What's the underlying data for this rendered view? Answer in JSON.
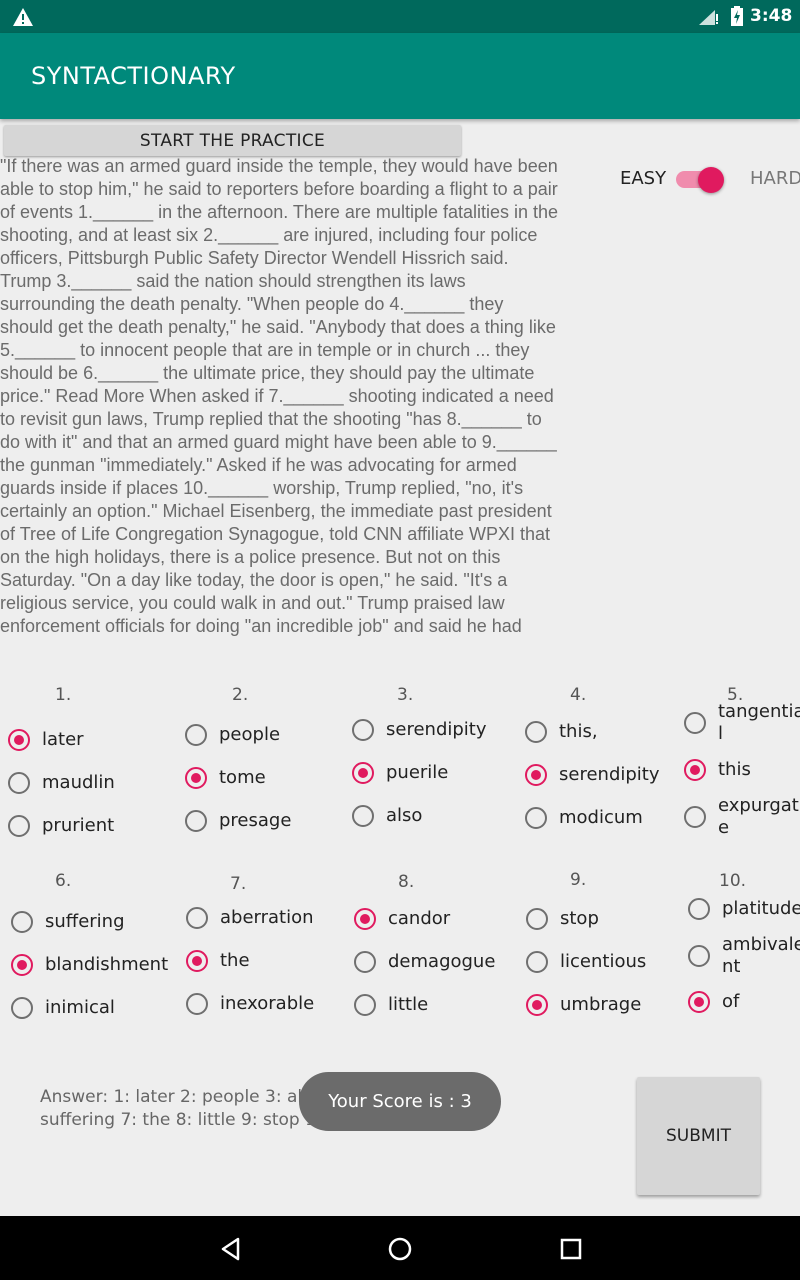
{
  "status_bar": {
    "time": "3:48",
    "icons": [
      "warning-icon",
      "signal-icon",
      "battery-icon"
    ]
  },
  "app_bar": {
    "title": "SYNTACTIONARY"
  },
  "start_button": {
    "label": "START THE PRACTICE"
  },
  "passage": "\"If there was an armed guard inside the temple, they would have been able to stop him,\" he said to reporters before boarding a flight to a pair of events 1.______ in the afternoon. There are multiple fatalities in the shooting, and at least six 2.______ are injured, including four police officers, Pittsburgh Public Safety Director Wendell Hissrich said. Trump 3.______ said the nation should strengthen its laws surrounding the death penalty. \"When people do 4.______ they should get the death penalty,\" he said. \"Anybody that does a thing like 5.______ to innocent people that are in temple or in church ... they should be 6.______ the ultimate price, they should pay the ultimate price.\" Read More When asked if 7.______ shooting indicated a need to revisit gun laws, Trump replied that the shooting \"has 8.______ to do with it\" and that an armed guard might have been able to 9.______ the gunman \"immediately.\" Asked if he was advocating for armed guards inside if places 10.______ worship, Trump replied, \"no, it's certainly an option.\" Michael Eisenberg, the immediate past president of Tree of Life Congregation Synagogue, told CNN affiliate WPXI that on the high holidays, there is a police presence. But not on this Saturday. \"On a day like today, the door is open,\" he said. \"It's a religious service, you could walk in and out.\" Trump praised law enforcement officials for doing \"an incredible job\" and said he had",
  "difficulty": {
    "easy_label": "EASY",
    "hard_label": "HARD",
    "switch_on": true
  },
  "questions": [
    {
      "number": "1.",
      "options": [
        "later",
        "maudlin",
        "prurient"
      ],
      "selected": 0
    },
    {
      "number": "2.",
      "options": [
        "people",
        "tome",
        "presage"
      ],
      "selected": 1
    },
    {
      "number": "3.",
      "options": [
        "serendipity",
        "puerile",
        "also"
      ],
      "selected": 1
    },
    {
      "number": "4.",
      "options": [
        "this,",
        "serendipity",
        "modicum"
      ],
      "selected": 1
    },
    {
      "number": "5.",
      "options": [
        "tangentia\nl",
        "this",
        "expurgat\ne"
      ],
      "selected": 1
    },
    {
      "number": "6.",
      "options": [
        "suffering",
        "blandishment",
        "inimical"
      ],
      "selected": 1
    },
    {
      "number": "7.",
      "options": [
        "aberration",
        "the",
        "inexorable"
      ],
      "selected": 1
    },
    {
      "number": "8.",
      "options": [
        "candor",
        "demagogue",
        "little"
      ],
      "selected": 0
    },
    {
      "number": "9.",
      "options": [
        "stop",
        "licentious",
        "umbrage"
      ],
      "selected": 2
    },
    {
      "number": "10.",
      "options": [
        "platitude",
        "ambivale\nnt",
        "of"
      ],
      "selected": 2
    }
  ],
  "answer_text": "Answer: 1: later 2: people 3: also 4: this 5: this 6: suffering 7: the 8: little 9: stop 10: of",
  "toast": "Your Score is : 3",
  "submit_button": {
    "label": "SUBMIT"
  },
  "colors": {
    "status_bar": "#00695c",
    "app_bar": "#00897b",
    "accent": "#e01a5f"
  }
}
